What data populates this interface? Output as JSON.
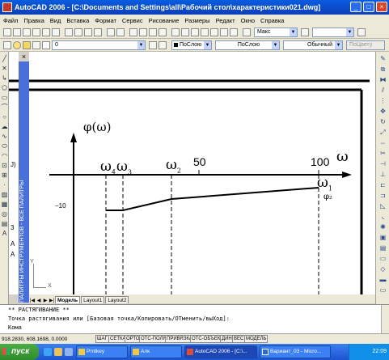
{
  "window": {
    "title": "AutoCAD 2006 - [C:\\Documents and Settings\\all\\Рабочий стол\\характеристики021.dwg]",
    "controls": [
      "_",
      "□",
      "×"
    ]
  },
  "menu": [
    "Файл",
    "Правка",
    "Вид",
    "Вставка",
    "Формат",
    "Сервис",
    "Рисование",
    "Размеры",
    "Редакт",
    "Окно",
    "Справка"
  ],
  "toolbar1": {
    "textstyle_value": "Макс"
  },
  "toolbar2": {
    "layer_value": "0",
    "color_value": "ПоСлою",
    "linetype_value": "ПоСлою",
    "lineweight_value": "Обычный",
    "plotstyle_value": "ПоЦвету"
  },
  "palettes": {
    "label": "ПАЛИТРЫ ИНСТРУМЕНТОВ - ВСЕ ПАЛИТРЫ",
    "close": "×"
  },
  "drawing": {
    "y_axis_label": "φ(ω)",
    "x_axis_label": "ω",
    "tick_50": "50",
    "tick_100": "100",
    "y_tick": "−10",
    "w4": "ω",
    "w4_sub": "4",
    "w3": "ω",
    "w3_sub": "3",
    "w2": "ω",
    "w2_sub": "2",
    "w1": "ω",
    "w1_sub": "1",
    "phi2": "φ₂",
    "side_labels": [
      "J)",
      "3",
      "A",
      "A"
    ],
    "ucs_x": "X",
    "ucs_y": "Y"
  },
  "tabs": {
    "nav": [
      "|◀",
      "◀",
      "▶",
      "▶|"
    ],
    "items": [
      "Модель",
      "Layout1",
      "Layout2"
    ]
  },
  "command": {
    "line1": "** РАСТЯГИВАНИЕ **",
    "line2": "Точка растягивания или [Базовая точка/Копировать/ОТменить/выХод]:",
    "line3": "Кома"
  },
  "status": {
    "coords": "918.2830, 608.1698, 0.0000",
    "buttons": [
      "ШАГ",
      "СЕТКА",
      "ОРТО",
      "ОТС-ПОЛЯР",
      "ПРИВЯЗКА",
      "ОТС-ОБЪЕКТ",
      "ДИН",
      "ВЕС",
      "МОДЕЛЬ"
    ]
  },
  "taskbar": {
    "start": "пуск",
    "tasks": [
      "Prntkey",
      "Алк",
      "AutoCAD 2006 - [C:\\...",
      "Вариант_03 - Micro..."
    ],
    "clock": "22:09"
  }
}
